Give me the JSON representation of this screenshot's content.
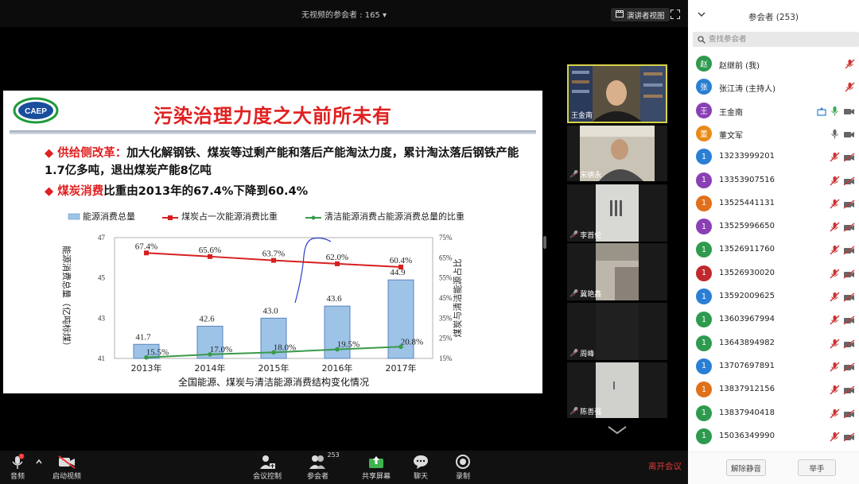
{
  "topbar": {
    "viewer_count": "无视频的参会者 : 165 ▾",
    "speaker_view_label": "演讲者视图"
  },
  "slide": {
    "logo_text": "CAEP",
    "title": "污染治理力度之大前所未有",
    "bullet1_highlight": "供给侧改革：",
    "bullet1_text": "加大化解钢铁、煤炭等过剩产能和落后产能淘汰力度，累计淘汰落后钢铁产能1.7亿多吨，退出煤炭产能8亿吨",
    "bullet2_highlight": "煤炭消费",
    "bullet2_text": "比重由2013年的67.4%下降到60.4%"
  },
  "chart_data": {
    "type": "bar+line",
    "title": "全国能源、煤炭与清洁能源消费结构变化情况",
    "categories": [
      "2013年",
      "2014年",
      "2015年",
      "2016年",
      "2017年"
    ],
    "ylabel_left": "能源消费总量（亿吨标煤）",
    "ylabel_right": "煤炭与清洁能源占比",
    "ylim_left": [
      41,
      47
    ],
    "yticks_left": [
      "41",
      "43",
      "45",
      "47"
    ],
    "ylim_right": [
      15,
      75
    ],
    "yticks_right": [
      "15%",
      "25%",
      "35%",
      "45%",
      "55%",
      "65%",
      "75%"
    ],
    "series": [
      {
        "name": "能源消费总量",
        "kind": "bar",
        "color": "#9dc3e6",
        "values": [
          41.7,
          42.6,
          43.0,
          43.6,
          44.9
        ],
        "labels": [
          "41.7",
          "42.6",
          "43.0",
          "43.6",
          "44.9"
        ]
      },
      {
        "name": "煤炭占一次能源消费比重",
        "kind": "line",
        "color": "#d62020",
        "values": [
          67.4,
          65.6,
          63.7,
          62.0,
          60.4
        ],
        "labels": [
          "67.4%",
          "65.6%",
          "63.7%",
          "62.0%",
          "60.4%"
        ]
      },
      {
        "name": "清洁能源消费占能源消费总量的比重",
        "kind": "line",
        "color": "#3a9a4a",
        "values": [
          15.5,
          17.0,
          18.0,
          19.5,
          20.8
        ],
        "labels": [
          "15.5%",
          "17.0%",
          "18.0%",
          "19.5%",
          "20.8%"
        ]
      }
    ]
  },
  "thumbnails": [
    {
      "name": "王金南",
      "muted": false,
      "active": true
    },
    {
      "name": "宋德永",
      "muted": true,
      "active": false
    },
    {
      "name": "李首伦",
      "muted": true,
      "active": false
    },
    {
      "name": "冀艳鑫",
      "muted": true,
      "active": false
    },
    {
      "name": "周峰",
      "muted": true,
      "active": false
    },
    {
      "name": "陈善强",
      "muted": true,
      "active": false
    }
  ],
  "toolbar": {
    "audio": "音频",
    "video": "启动视频",
    "controls": "会议控制",
    "participants": "参会者",
    "participants_count": "253",
    "share": "共享屏幕",
    "chat": "聊天",
    "record": "录制",
    "leave": "离开会议"
  },
  "panel": {
    "title": "参会者 (253)",
    "search_placeholder": "查找参会者",
    "mute_all": "解除静音",
    "raise_hand": "举手",
    "participants": [
      {
        "avatar": "赵",
        "name": "赵继前 (我)",
        "color": "#2e9a4e",
        "state": "host-muted"
      },
      {
        "avatar": "张",
        "name": "张江涛 (主持人)",
        "color": "#2a7fd4",
        "state": "host-muted"
      },
      {
        "avatar": "王",
        "name": "王金南",
        "color": "#8a3fb5",
        "state": "speaking"
      },
      {
        "avatar": "董",
        "name": "董文军",
        "color": "#e98a17",
        "state": "mic-cam"
      },
      {
        "avatar": "1",
        "name": "13233999201",
        "color": "#2a7fd4",
        "state": "muted"
      },
      {
        "avatar": "1",
        "name": "13353907516",
        "color": "#8a3fb5",
        "state": "muted"
      },
      {
        "avatar": "1",
        "name": "13525441131",
        "color": "#e0701a",
        "state": "muted"
      },
      {
        "avatar": "1",
        "name": "13525996650",
        "color": "#8a3fb5",
        "state": "muted"
      },
      {
        "avatar": "1",
        "name": "13526911760",
        "color": "#2e9a4e",
        "state": "muted"
      },
      {
        "avatar": "1",
        "name": "13526930020",
        "color": "#c0282e",
        "state": "muted"
      },
      {
        "avatar": "1",
        "name": "13592009625",
        "color": "#2a7fd4",
        "state": "muted"
      },
      {
        "avatar": "1",
        "name": "13603967994",
        "color": "#2e9a4e",
        "state": "muted"
      },
      {
        "avatar": "1",
        "name": "13643894982",
        "color": "#2e9a4e",
        "state": "muted"
      },
      {
        "avatar": "1",
        "name": "13707697891",
        "color": "#2a7fd4",
        "state": "muted"
      },
      {
        "avatar": "1",
        "name": "13837912156",
        "color": "#e0701a",
        "state": "muted"
      },
      {
        "avatar": "1",
        "name": "13837940418",
        "color": "#2e9a4e",
        "state": "muted"
      },
      {
        "avatar": "1",
        "name": "15036349990",
        "color": "#2e9a4e",
        "state": "muted"
      }
    ]
  }
}
